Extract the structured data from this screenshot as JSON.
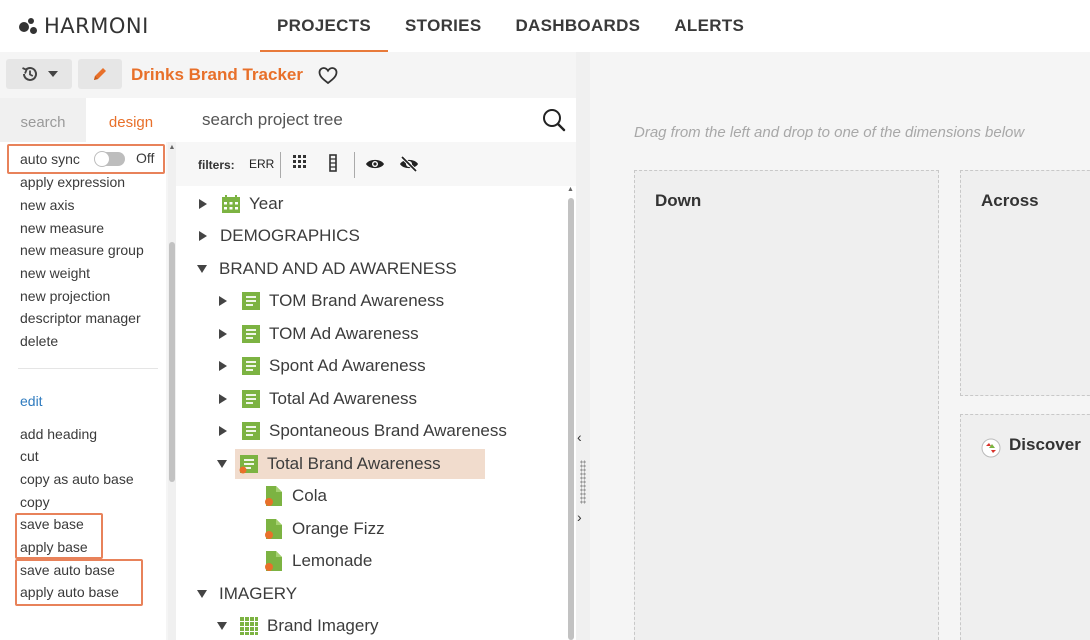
{
  "brand": {
    "name": "HARMONI"
  },
  "nav": [
    {
      "label": "PROJECTS",
      "active": true
    },
    {
      "label": "STORIES",
      "active": false
    },
    {
      "label": "DASHBOARDS",
      "active": false
    },
    {
      "label": "ALERTS",
      "active": false
    }
  ],
  "toolbar": {
    "project_title": "Drinks Brand Tracker"
  },
  "left_tabs": {
    "search": "search",
    "design": "design"
  },
  "design_menu": {
    "auto_sync": {
      "label": "auto sync",
      "state": "Off"
    },
    "items": [
      "apply expression",
      "new axis",
      "new measure",
      "new measure group",
      "new weight",
      "new projection",
      "descriptor manager",
      "delete"
    ],
    "edit_link": "edit",
    "edit_items": [
      "add heading",
      "cut",
      "copy as auto base",
      "copy",
      "save base",
      "apply base",
      "save auto base",
      "apply auto base"
    ]
  },
  "tree_search": {
    "placeholder": "search project tree"
  },
  "filters": {
    "label": "filters:",
    "err": "ERR"
  },
  "tree": [
    {
      "label": "Year",
      "icon": "calendar-icon"
    },
    {
      "label": "DEMOGRAPHICS"
    },
    {
      "label": "BRAND AND AD AWARENESS",
      "expanded": true
    },
    {
      "label": "TOM Brand Awareness",
      "icon": "question-icon"
    },
    {
      "label": "TOM Ad Awareness",
      "icon": "question-icon"
    },
    {
      "label": "Spont Ad Awareness",
      "icon": "question-icon"
    },
    {
      "label": "Total Ad Awareness",
      "icon": "question-icon"
    },
    {
      "label": "Spontaneous Brand Awareness",
      "icon": "question-icon"
    },
    {
      "label": "Total Brand Awareness",
      "icon": "question-icon",
      "selected": true,
      "expanded": true
    },
    {
      "label": "Cola",
      "icon": "code-icon"
    },
    {
      "label": "Orange Fizz",
      "icon": "code-icon"
    },
    {
      "label": "Lemonade",
      "icon": "code-icon"
    },
    {
      "label": "IMAGERY",
      "expanded": true
    },
    {
      "label": "Brand Imagery",
      "icon": "grid-question-icon",
      "expanded": true
    }
  ],
  "workspace": {
    "hint": "Drag from the left and drop to one of the dimensions below",
    "zones": {
      "down": "Down",
      "across": "Across",
      "discover": "Discover"
    }
  },
  "colors": {
    "accent": "#e8702a",
    "link": "#2f7bbf",
    "icon_green": "#7cb342",
    "highlight": "#e8825a",
    "selected_row": "#f1dccd"
  }
}
